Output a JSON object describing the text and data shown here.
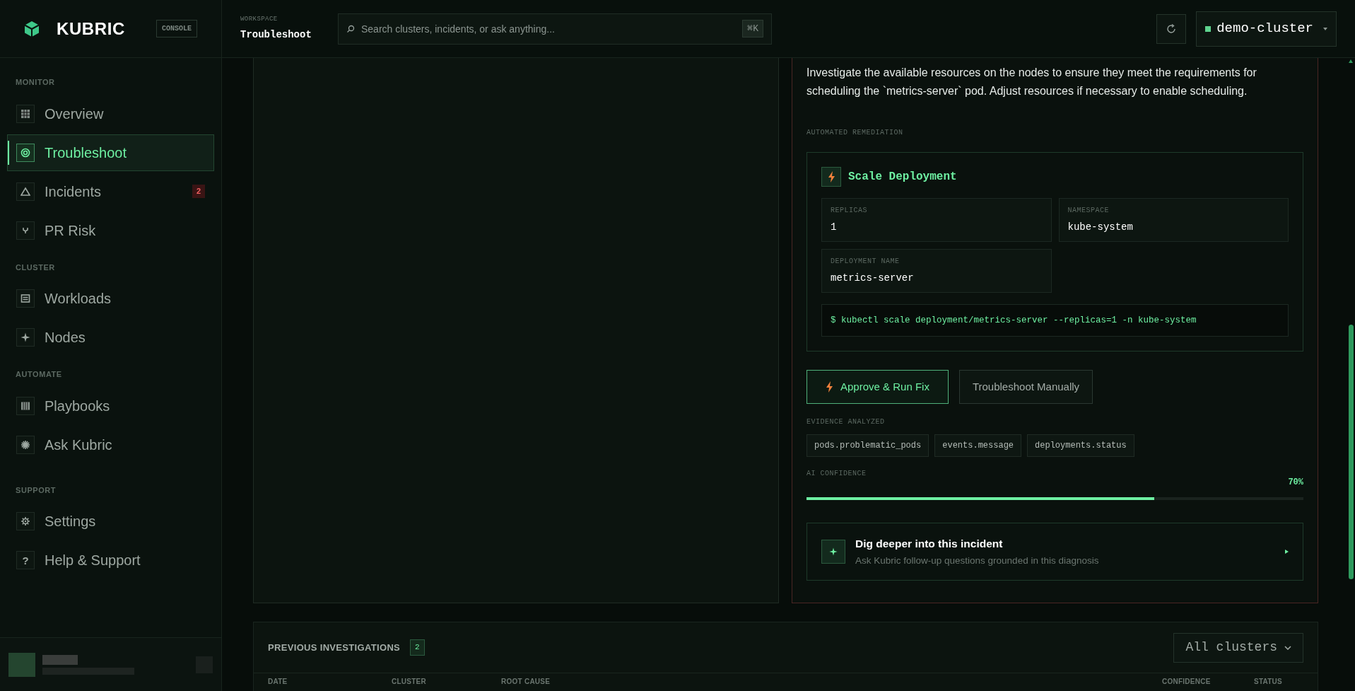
{
  "brand": {
    "name": "KUBRIC",
    "tag": "CONSOLE"
  },
  "sidebar": {
    "sections": [
      {
        "title": "MONITOR",
        "items": [
          {
            "label": "Overview",
            "kind": "grid",
            "selected": false
          },
          {
            "label": "Troubleshoot",
            "kind": "target",
            "selected": true
          },
          {
            "label": "Incidents",
            "kind": "triangle",
            "selected": false,
            "badge": "2"
          },
          {
            "label": "PR Risk",
            "kind": "fork",
            "selected": false
          }
        ]
      },
      {
        "title": "CLUSTER",
        "items": [
          {
            "label": "Workloads",
            "kind": "list",
            "selected": false
          },
          {
            "label": "Nodes",
            "kind": "sparkle",
            "selected": false
          }
        ]
      },
      {
        "title": "AUTOMATE",
        "items": [
          {
            "label": "Playbooks",
            "kind": "columns",
            "selected": false
          },
          {
            "label": "Ask Kubric",
            "kind": "burst",
            "selected": false
          }
        ]
      },
      {
        "title": "SUPPORT",
        "items": [
          {
            "label": "Settings",
            "kind": "gear",
            "selected": false
          },
          {
            "label": "Help & Support",
            "kind": "text",
            "icon_text": "?",
            "selected": false
          }
        ]
      }
    ]
  },
  "topbar": {
    "workspace_label": "WORKSPACE",
    "workspace": "Troubleshoot",
    "search": {
      "placeholder": "Search clusters, incidents, or ask anything...",
      "shortcut": "⌘K"
    },
    "cluster": {
      "name": "demo-cluster",
      "color": "#5fd48f"
    }
  },
  "diagnosis": {
    "recommendation": "Investigate the available resources on the nodes to ensure they meet the requirements for scheduling the `metrics-server` pod. Adjust resources if necessary to enable scheduling.",
    "remediation_label": "AUTOMATED REMEDIATION",
    "remediation": {
      "title": "Scale Deployment",
      "fields": [
        {
          "label": "REPLICAS",
          "value": "1"
        },
        {
          "label": "NAMESPACE",
          "value": "kube-system"
        },
        {
          "label": "DEPLOYMENT NAME",
          "value": "metrics-server"
        }
      ],
      "command": "$ kubectl scale deployment/metrics-server --replicas=1 -n kube-system"
    },
    "buttons": [
      {
        "label": "Approve & Run Fix",
        "kind": "primary"
      },
      {
        "label": "Troubleshoot Manually",
        "kind": "secondary"
      }
    ],
    "evidence_label": "EVIDENCE ANALYZED",
    "evidence": [
      "pods.problematic_pods",
      "events.message",
      "deployments.status"
    ],
    "confidence": {
      "label": "AI CONFIDENCE",
      "level": 0.7,
      "reading": "70%"
    },
    "dig": {
      "title": "Dig deeper into this incident",
      "subtitle": "Ask Kubric follow-up questions grounded in this diagnosis"
    }
  },
  "investigations": {
    "title": "PREVIOUS INVESTIGATIONS",
    "count": "2",
    "filter": "All clusters",
    "columns": [
      "DATE",
      "CLUSTER",
      "ROOT CAUSE",
      "CONFIDENCE",
      "STATUS"
    ]
  }
}
